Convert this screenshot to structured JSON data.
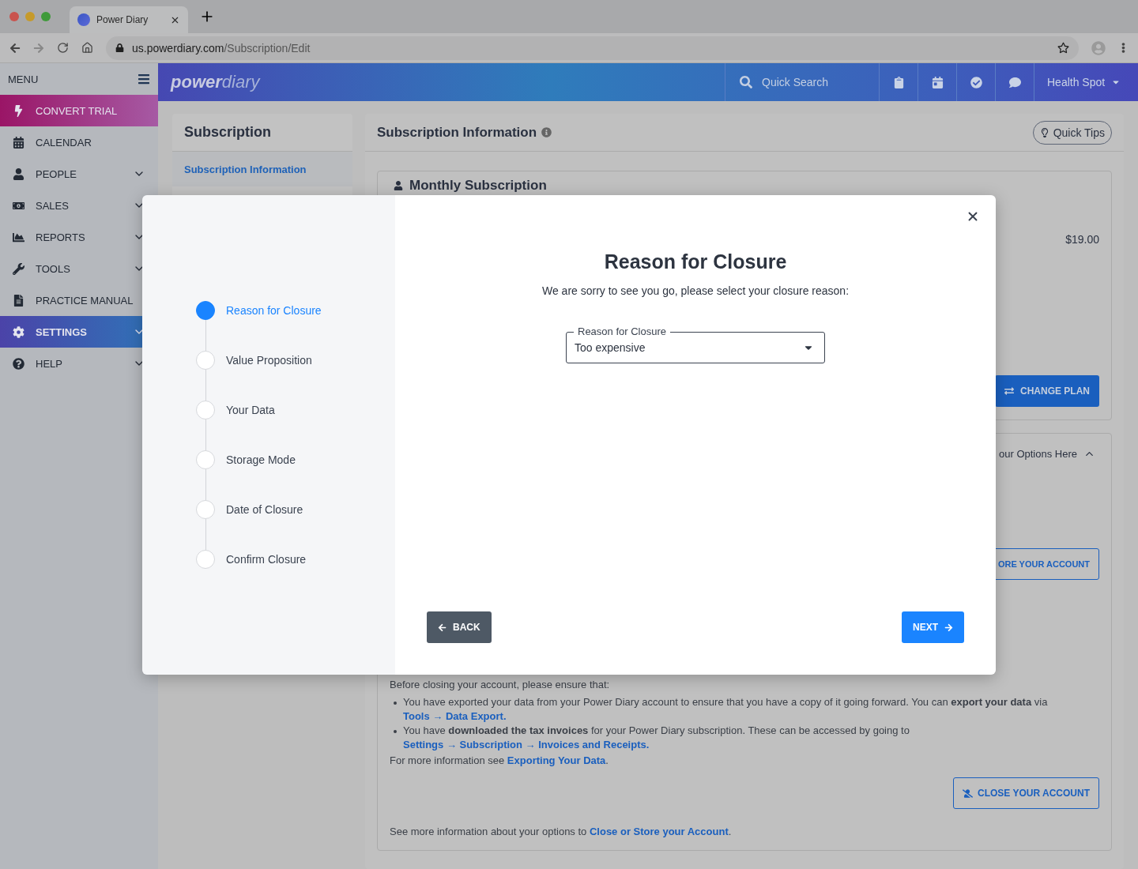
{
  "browser": {
    "tab_title": "Power Diary",
    "url_host": "us.powerdiary.com",
    "url_path": "/Subscription/Edit"
  },
  "sidebar": {
    "title": "MENU",
    "items": [
      {
        "label": "CONVERT TRIAL",
        "kind": "promo",
        "expandable": false,
        "selected": false
      },
      {
        "label": "CALENDAR",
        "kind": "link",
        "expandable": false,
        "selected": false
      },
      {
        "label": "PEOPLE",
        "kind": "link",
        "expandable": true,
        "selected": false
      },
      {
        "label": "SALES",
        "kind": "link",
        "expandable": true,
        "selected": false
      },
      {
        "label": "REPORTS",
        "kind": "link",
        "expandable": true,
        "selected": false
      },
      {
        "label": "TOOLS",
        "kind": "link",
        "expandable": true,
        "selected": false
      },
      {
        "label": "PRACTICE MANUAL",
        "kind": "link",
        "expandable": false,
        "selected": false
      },
      {
        "label": "SETTINGS",
        "kind": "link",
        "expandable": true,
        "selected": true
      },
      {
        "label": "HELP",
        "kind": "link",
        "expandable": true,
        "selected": false
      }
    ]
  },
  "topbar": {
    "logo_bold": "power",
    "logo_light": "diary",
    "search_placeholder": "Quick Search",
    "account": "Health Spot"
  },
  "subnav": {
    "title": "Subscription",
    "items": [
      {
        "label": "Subscription Information",
        "selected": true
      }
    ]
  },
  "panel": {
    "title": "Subscription Information",
    "quick_tips": "Quick Tips",
    "plan": {
      "title": "Monthly Subscription",
      "price": "$19.00",
      "change_button": "CHANGE PLAN"
    },
    "options": {
      "header": "our Options Here",
      "expanded": true,
      "store_button": "ORE YOUR ACCOUNT",
      "intro": "Before closing your account, please ensure that:",
      "bullets": [
        {
          "text": "You have exported your data from your Power Diary account to ensure that you have a copy of it going forward. You can **export your data** via",
          "link": "Tools → Data Export."
        },
        {
          "text": "You have **downloaded the tax invoices** for your Power Diary subscription. These can be accessed by going to",
          "link": "Settings → Subscription → Invoices and Receipts."
        }
      ],
      "more_info": {
        "text": "For more information see",
        "link": "Exporting Your Data",
        "after": "."
      },
      "close_button": "CLOSE YOUR ACCOUNT",
      "footer": {
        "text": "See more information about your options to",
        "link": "Close or Store your Account",
        "after": "."
      }
    }
  },
  "modal": {
    "steps": [
      {
        "label": "Reason for Closure",
        "selected": true
      },
      {
        "label": "Value Proposition",
        "selected": false
      },
      {
        "label": "Your Data",
        "selected": false
      },
      {
        "label": "Storage Mode",
        "selected": false
      },
      {
        "label": "Date of Closure",
        "selected": false
      },
      {
        "label": "Confirm Closure",
        "selected": false
      }
    ],
    "title": "Reason for Closure",
    "subtitle": "We are sorry to see you go, please select your closure reason:",
    "select": {
      "label": "Reason for Closure",
      "value": "Too expensive"
    },
    "back": "BACK",
    "next": "NEXT"
  }
}
